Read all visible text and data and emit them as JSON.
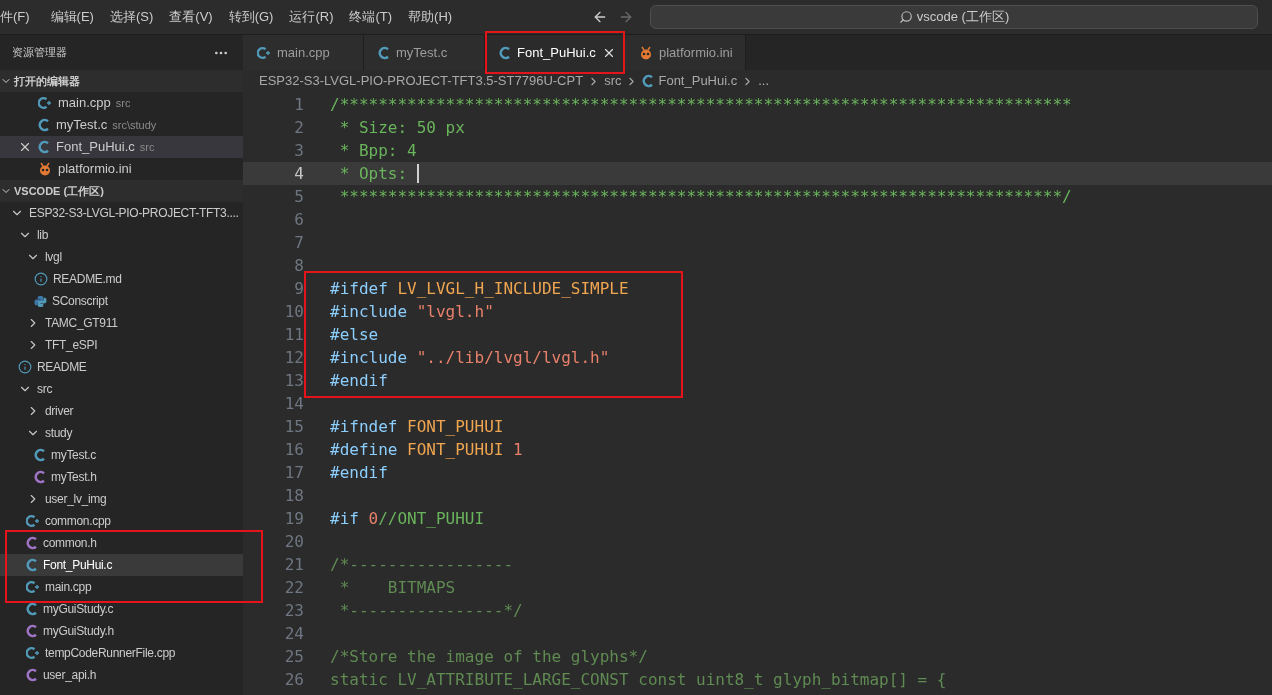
{
  "menu": [
    "件(F)",
    "编辑(E)",
    "选择(S)",
    "查看(V)",
    "转到(G)",
    "运行(R)",
    "终端(T)",
    "帮助(H)"
  ],
  "nav": [
    {
      "kind": "back",
      "disabled": false
    },
    {
      "kind": "forward",
      "disabled": true
    }
  ],
  "command_center": {
    "text": "vscode (工作区)"
  },
  "explorer": {
    "title": "资源管理器",
    "open_editors": {
      "title": "打开的编辑器",
      "expanded": true,
      "items": [
        {
          "name": "main.cpp",
          "path": "src",
          "kind": "cpp",
          "selected": false
        },
        {
          "name": "myTest.c",
          "path": "src\\study",
          "kind": "c",
          "selected": false
        },
        {
          "name": "Font_PuHui.c",
          "path": "src",
          "kind": "c",
          "selected": true
        },
        {
          "name": "platformio.ini",
          "kind": "pio",
          "selected": false
        }
      ]
    },
    "workspace": {
      "title": "VSCODE (工作区)",
      "expanded": true,
      "tree": [
        {
          "kind": "folder",
          "name": "ESP32-S3-LVGL-PIO-PROJECT-TFT3....",
          "expanded": true,
          "selected": false,
          "annotated": false,
          "children": [
            {
              "kind": "folder",
              "name": "lib",
              "expanded": true,
              "selected": false,
              "annotated": false,
              "children": [
                {
                  "kind": "folder",
                  "name": "lvgl",
                  "expanded": true,
                  "selected": false,
                  "annotated": false,
                  "children": [
                    {
                      "kind": "info",
                      "name": "README.md",
                      "selected": false,
                      "annotated": false
                    },
                    {
                      "kind": "python",
                      "name": "SConscript",
                      "selected": false,
                      "annotated": false
                    }
                  ]
                },
                {
                  "kind": "folder",
                  "name": "TAMC_GT911",
                  "expanded": false,
                  "selected": false,
                  "annotated": false
                },
                {
                  "kind": "folder",
                  "name": "TFT_eSPI",
                  "expanded": false,
                  "selected": false,
                  "annotated": false
                }
              ]
            },
            {
              "kind": "info",
              "name": "README",
              "selected": false,
              "annotated": false
            },
            {
              "kind": "folder",
              "name": "src",
              "expanded": true,
              "selected": false,
              "annotated": false,
              "children": [
                {
                  "kind": "folder",
                  "name": "driver",
                  "expanded": false,
                  "selected": false,
                  "annotated": false
                },
                {
                  "kind": "folder",
                  "name": "study",
                  "expanded": true,
                  "selected": false,
                  "annotated": false,
                  "children": [
                    {
                      "kind": "c",
                      "name": "myTest.c",
                      "selected": false,
                      "annotated": false
                    },
                    {
                      "kind": "h",
                      "name": "myTest.h",
                      "selected": false,
                      "annotated": false
                    }
                  ]
                },
                {
                  "kind": "folder",
                  "name": "user_lv_img",
                  "expanded": false,
                  "selected": false,
                  "annotated": false
                },
                {
                  "kind": "cpp",
                  "name": "common.cpp",
                  "selected": false,
                  "annotated": false
                },
                {
                  "kind": "h",
                  "name": "common.h",
                  "selected": false,
                  "annotated": true
                },
                {
                  "kind": "c",
                  "name": "Font_PuHui.c",
                  "selected": true,
                  "annotated": true
                },
                {
                  "kind": "cpp",
                  "name": "main.cpp",
                  "selected": false,
                  "annotated": true
                },
                {
                  "kind": "c",
                  "name": "myGuiStudy.c",
                  "selected": false,
                  "annotated": false
                },
                {
                  "kind": "h",
                  "name": "myGuiStudy.h",
                  "selected": false,
                  "annotated": false
                },
                {
                  "kind": "cpp",
                  "name": "tempCodeRunnerFile.cpp",
                  "selected": false,
                  "annotated": false
                },
                {
                  "kind": "h",
                  "name": "user_api.h",
                  "selected": false,
                  "annotated": false
                }
              ]
            }
          ]
        }
      ]
    }
  },
  "tabs": [
    {
      "label": "main.cpp",
      "kind": "cpp",
      "selected": false,
      "annotated": false
    },
    {
      "label": "myTest.c",
      "kind": "c",
      "selected": false,
      "annotated": false
    },
    {
      "label": "Font_PuHui.c",
      "kind": "c",
      "selected": true,
      "annotated": true
    },
    {
      "label": "platformio.ini",
      "kind": "pio",
      "selected": false,
      "annotated": false
    }
  ],
  "breadcrumb": [
    {
      "label": "ESP32-S3-LVGL-PIO-PROJECT-TFT3.5-ST7796U-CPT",
      "kind": "folder"
    },
    {
      "label": "src",
      "kind": "folder"
    },
    {
      "label": "Font_PuHui.c",
      "kind": "c"
    },
    {
      "label": "...",
      "kind": "symbol"
    }
  ],
  "code": [
    {
      "number": "1",
      "selected": false,
      "annotated": false,
      "tokens": [
        {
          "kind": "comment",
          "text": "/****************************************************************************"
        }
      ]
    },
    {
      "number": "2",
      "selected": false,
      "annotated": false,
      "tokens": [
        {
          "kind": "comment",
          "text": " * Size: 50 px"
        }
      ]
    },
    {
      "number": "3",
      "selected": false,
      "annotated": false,
      "tokens": [
        {
          "kind": "comment",
          "text": " * Bpp: 4"
        }
      ]
    },
    {
      "number": "4",
      "selected": true,
      "annotated": false,
      "tokens": [
        {
          "kind": "comment",
          "text": " * Opts: "
        }
      ]
    },
    {
      "number": "5",
      "selected": false,
      "annotated": false,
      "tokens": [
        {
          "kind": "comment",
          "text": " ***************************************************************************/"
        }
      ]
    },
    {
      "number": "6",
      "selected": false,
      "annotated": false
    },
    {
      "number": "7",
      "selected": false,
      "annotated": false
    },
    {
      "number": "8",
      "selected": false,
      "annotated": false
    },
    {
      "number": "9",
      "selected": false,
      "annotated": true,
      "tokens": [
        {
          "kind": "directive",
          "text": "#ifdef "
        },
        {
          "kind": "macro",
          "text": "LV_LVGL_H_INCLUDE_SIMPLE"
        }
      ]
    },
    {
      "number": "10",
      "selected": false,
      "annotated": true,
      "tokens": [
        {
          "kind": "directive",
          "text": "#include "
        },
        {
          "kind": "string",
          "text": "\"lvgl.h\""
        }
      ]
    },
    {
      "number": "11",
      "selected": false,
      "annotated": true,
      "tokens": [
        {
          "kind": "directive",
          "text": "#else"
        }
      ]
    },
    {
      "number": "12",
      "selected": false,
      "annotated": true,
      "tokens": [
        {
          "kind": "directive",
          "text": "#include "
        },
        {
          "kind": "string",
          "text": "\"../lib/lvgl/lvgl.h\""
        }
      ]
    },
    {
      "number": "13",
      "selected": false,
      "annotated": true,
      "tokens": [
        {
          "kind": "directive",
          "text": "#endif"
        }
      ]
    },
    {
      "number": "14",
      "selected": false,
      "annotated": false
    },
    {
      "number": "15",
      "selected": false,
      "annotated": false,
      "tokens": [
        {
          "kind": "directive",
          "text": "#ifndef "
        },
        {
          "kind": "macro",
          "text": "FONT_PUHUI"
        }
      ]
    },
    {
      "number": "16",
      "selected": false,
      "annotated": false,
      "tokens": [
        {
          "kind": "directive",
          "text": "#define "
        },
        {
          "kind": "macro",
          "text": "FONT_PUHUI "
        },
        {
          "kind": "number",
          "text": "1"
        }
      ]
    },
    {
      "number": "17",
      "selected": false,
      "annotated": false,
      "tokens": [
        {
          "kind": "directive",
          "text": "#endif"
        }
      ]
    },
    {
      "number": "18",
      "selected": false,
      "annotated": false
    },
    {
      "number": "19",
      "selected": false,
      "annotated": false,
      "tokens": [
        {
          "kind": "directive",
          "text": "#if "
        },
        {
          "kind": "number",
          "text": "0"
        },
        {
          "kind": "comment",
          "text": "//ONT_PUHUI"
        }
      ]
    },
    {
      "number": "20",
      "selected": false,
      "annotated": false
    },
    {
      "number": "21",
      "selected": false,
      "annotated": false,
      "tokens": [
        {
          "kind": "inactive",
          "text": "/*-----------------"
        }
      ]
    },
    {
      "number": "22",
      "selected": false,
      "annotated": false,
      "tokens": [
        {
          "kind": "inactive",
          "text": " *    BITMAPS"
        }
      ]
    },
    {
      "number": "23",
      "selected": false,
      "annotated": false,
      "tokens": [
        {
          "kind": "inactive",
          "text": " *----------------*/"
        }
      ]
    },
    {
      "number": "24",
      "selected": false,
      "annotated": false
    },
    {
      "number": "25",
      "selected": false,
      "annotated": false,
      "tokens": [
        {
          "kind": "inactive",
          "text": "/*Store the image of the glyphs*/"
        }
      ]
    },
    {
      "number": "26",
      "selected": false,
      "annotated": false,
      "tokens": [
        {
          "kind": "inactive",
          "text": "static LV_ATTRIBUTE_LARGE_CONST const uint8_t glyph_bitmap[] = {"
        }
      ]
    }
  ]
}
